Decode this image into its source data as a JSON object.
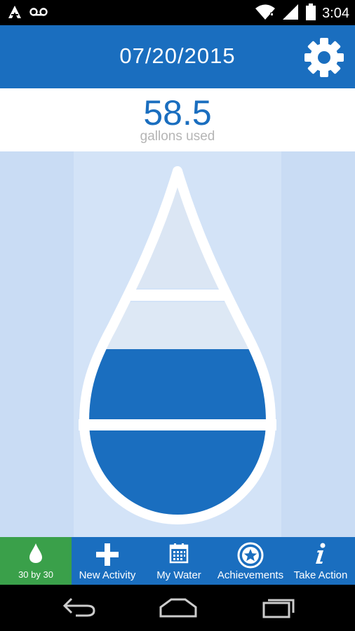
{
  "status_bar": {
    "time": "3:04",
    "icons": [
      "app-notification-icon",
      "voicemail-icon",
      "wifi-icon",
      "signal-icon",
      "battery-icon"
    ]
  },
  "header": {
    "date": "07/20/2015",
    "settings_icon": "gear-icon"
  },
  "usage": {
    "value": "58.5",
    "unit_label": "gallons used"
  },
  "bottom_nav": {
    "items": [
      {
        "label": "30 by 30",
        "icon": "water-drop-icon",
        "active": true
      },
      {
        "label": "New Activity",
        "icon": "plus-icon",
        "active": false
      },
      {
        "label": "My Water",
        "icon": "calendar-icon",
        "active": false
      },
      {
        "label": "Achievements",
        "icon": "star-badge-icon",
        "active": false
      },
      {
        "label": "Take Action",
        "icon": "info-icon",
        "active": false
      }
    ]
  },
  "system_nav": [
    "back-icon",
    "home-icon",
    "recents-icon"
  ],
  "colors": {
    "brand_blue": "#1a6ebf",
    "active_green": "#3aa04a",
    "background_light_blue": "#c9dcf4",
    "drop_outline": "#ffffff",
    "unit_gray": "#b5b5b5"
  }
}
